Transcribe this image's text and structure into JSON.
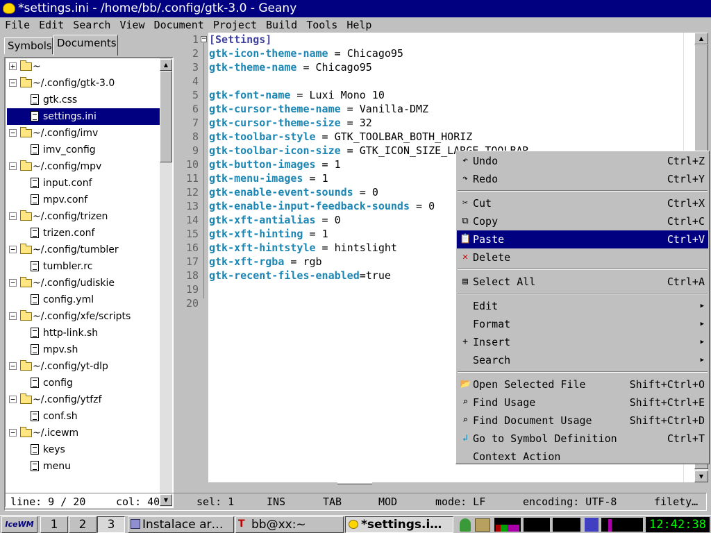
{
  "window": {
    "title": "*settings.ini - /home/bb/.config/gtk-3.0 - Geany"
  },
  "menubar": [
    "File",
    "Edit",
    "Search",
    "View",
    "Document",
    "Project",
    "Build",
    "Tools",
    "Help"
  ],
  "sidebar": {
    "tabs": [
      "Symbols",
      "Documents"
    ],
    "active_tab": "Documents",
    "tree": [
      {
        "label": "~",
        "type": "folder",
        "expander": "+",
        "indent": 0
      },
      {
        "label": "~/.config/gtk-3.0",
        "type": "folder",
        "expander": "−",
        "indent": 0
      },
      {
        "label": "gtk.css",
        "type": "file",
        "indent": 1
      },
      {
        "label": "settings.ini",
        "type": "file",
        "indent": 1,
        "selected": true
      },
      {
        "label": "~/.config/imv",
        "type": "folder",
        "expander": "−",
        "indent": 0
      },
      {
        "label": "imv_config",
        "type": "file",
        "indent": 1
      },
      {
        "label": "~/.config/mpv",
        "type": "folder",
        "expander": "−",
        "indent": 0
      },
      {
        "label": "input.conf",
        "type": "file",
        "indent": 1
      },
      {
        "label": "mpv.conf",
        "type": "file",
        "indent": 1
      },
      {
        "label": "~/.config/trizen",
        "type": "folder",
        "expander": "−",
        "indent": 0
      },
      {
        "label": "trizen.conf",
        "type": "file",
        "indent": 1
      },
      {
        "label": "~/.config/tumbler",
        "type": "folder",
        "expander": "−",
        "indent": 0
      },
      {
        "label": "tumbler.rc",
        "type": "file",
        "indent": 1
      },
      {
        "label": "~/.config/udiskie",
        "type": "folder",
        "expander": "−",
        "indent": 0
      },
      {
        "label": "config.yml",
        "type": "file",
        "indent": 1
      },
      {
        "label": "~/.config/xfe/scripts",
        "type": "folder",
        "expander": "−",
        "indent": 0
      },
      {
        "label": "http-link.sh",
        "type": "file",
        "indent": 1
      },
      {
        "label": "mpv.sh",
        "type": "file",
        "indent": 1
      },
      {
        "label": "~/.config/yt-dlp",
        "type": "folder",
        "expander": "−",
        "indent": 0
      },
      {
        "label": "config",
        "type": "file",
        "indent": 1
      },
      {
        "label": "~/.config/ytfzf",
        "type": "folder",
        "expander": "−",
        "indent": 0
      },
      {
        "label": "conf.sh",
        "type": "file",
        "indent": 1
      },
      {
        "label": "~/.icewm",
        "type": "folder",
        "expander": "−",
        "indent": 0
      },
      {
        "label": "keys",
        "type": "file",
        "indent": 1
      },
      {
        "label": "menu",
        "type": "file",
        "indent": 1
      }
    ]
  },
  "editor": {
    "line_numbers": [
      "1",
      "2",
      "3",
      "4",
      "5",
      "6",
      "7",
      "8",
      "9",
      "10",
      "11",
      "12",
      "13",
      "14",
      "15",
      "16",
      "17",
      "18",
      "19",
      "20"
    ],
    "lines": [
      {
        "key": "",
        "sep": "",
        "val": "",
        "section": "[Settings]"
      },
      {
        "key": "gtk-icon-theme-name",
        "sep": " = ",
        "val": "Chicago95"
      },
      {
        "key": "gtk-theme-name",
        "sep": " = ",
        "val": "Chicago95"
      },
      {
        "key": "",
        "sep": "",
        "val": ""
      },
      {
        "key": "gtk-font-name",
        "sep": " = ",
        "val": "Luxi Mono 10"
      },
      {
        "key": "gtk-cursor-theme-name",
        "sep": " = ",
        "val": "Vanilla-DMZ"
      },
      {
        "key": "gtk-cursor-theme-size",
        "sep": " = ",
        "val": "32"
      },
      {
        "key": "gtk-toolbar-style",
        "sep": " = ",
        "val": "GTK_TOOLBAR_BOTH_HORIZ"
      },
      {
        "key": "gtk-toolbar-icon-size",
        "sep": " = ",
        "val": "GTK_ICON_SIZE_LARGE_TOOLBAR"
      },
      {
        "key": "gtk-button-images",
        "sep": " = ",
        "val": "1"
      },
      {
        "key": "gtk-menu-images",
        "sep": " = ",
        "val": "1"
      },
      {
        "key": "gtk-enable-event-sounds",
        "sep": " = ",
        "val": "0"
      },
      {
        "key": "gtk-enable-input-feedback-sounds",
        "sep": " = ",
        "val": "0"
      },
      {
        "key": "gtk-xft-antialias",
        "sep": " = ",
        "val": "0"
      },
      {
        "key": "gtk-xft-hinting",
        "sep": " = ",
        "val": "1"
      },
      {
        "key": "gtk-xft-hintstyle",
        "sep": " = ",
        "val": "hintslight"
      },
      {
        "key": "gtk-xft-rgba",
        "sep": " = ",
        "val": "rgb"
      },
      {
        "key": "gtk-recent-files-enabled",
        "sep": "=",
        "val": "true"
      },
      {
        "key": "",
        "sep": "",
        "val": ""
      },
      {
        "key": "",
        "sep": "",
        "val": ""
      }
    ]
  },
  "context_menu": {
    "items": [
      {
        "label": "Undo",
        "accel": "Ctrl+Z",
        "icon": "undo-icon",
        "glyph": "↶"
      },
      {
        "label": "Redo",
        "accel": "Ctrl+Y",
        "icon": "redo-icon",
        "glyph": "↷"
      },
      {
        "sep": true
      },
      {
        "label": "Cut",
        "accel": "Ctrl+X",
        "icon": "scissors-icon",
        "glyph": "✂"
      },
      {
        "label": "Copy",
        "accel": "Ctrl+C",
        "icon": "copy-icon",
        "glyph": "⧉"
      },
      {
        "label": "Paste",
        "accel": "Ctrl+V",
        "icon": "paste-icon",
        "glyph": "📋",
        "highlighted": true
      },
      {
        "label": "Delete",
        "accel": "",
        "icon": "delete-icon",
        "glyph": "✕"
      },
      {
        "sep": true
      },
      {
        "label": "Select All",
        "accel": "Ctrl+A",
        "icon": "select-all-icon",
        "glyph": "▤"
      },
      {
        "sep": true
      },
      {
        "label": "Edit",
        "accel": "",
        "submenu": true
      },
      {
        "label": "Format",
        "accel": "",
        "submenu": true
      },
      {
        "label": "Insert",
        "accel": "",
        "submenu": true,
        "icon": "plus-icon",
        "glyph": "+"
      },
      {
        "label": "Search",
        "accel": "",
        "submenu": true
      },
      {
        "sep": true
      },
      {
        "label": "Open Selected File",
        "accel": "Shift+Ctrl+O",
        "icon": "open-folder-icon",
        "glyph": "📂"
      },
      {
        "label": "Find Usage",
        "accel": "Shift+Ctrl+E",
        "icon": "binoculars-icon",
        "glyph": "⌕"
      },
      {
        "label": "Find Document Usage",
        "accel": "Shift+Ctrl+D",
        "icon": "binoculars-icon",
        "glyph": "⌕"
      },
      {
        "label": "Go to Symbol Definition",
        "accel": "Ctrl+T",
        "icon": "jump-icon",
        "glyph": "↲"
      },
      {
        "label": "Context Action",
        "accel": ""
      }
    ]
  },
  "statusbar": {
    "line": "line: 9 / 20",
    "col": "col: 40",
    "sel": "sel: 1",
    "ins": "INS",
    "tab": "TAB",
    "mod": "MOD",
    "mode": "mode: LF",
    "encoding": "encoding: UTF-8",
    "filetype": "filety…"
  },
  "taskbar": {
    "start": "IceWM",
    "workspaces": [
      "1",
      "2",
      "3"
    ],
    "active_workspace": "3",
    "tasks": [
      "Instalace ar…",
      "bb@xx:~",
      "*settings.i…"
    ],
    "clock": "12:42:38"
  },
  "colors": {
    "title_bg": "#000080",
    "key_color": "#1b86b4",
    "section_color": "#4040a0",
    "selection": "#000080",
    "clock_fg": "#00ff00"
  }
}
